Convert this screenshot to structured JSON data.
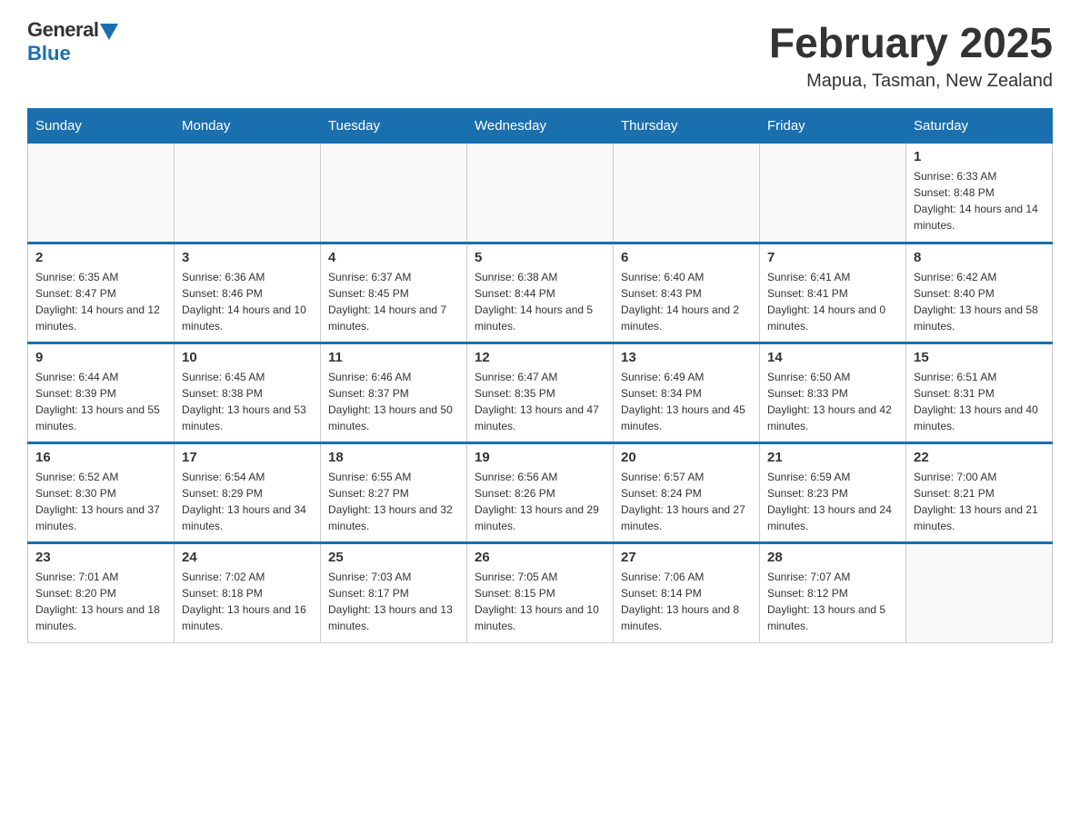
{
  "logo": {
    "general_text": "General",
    "blue_text": "Blue"
  },
  "header": {
    "title": "February 2025",
    "location": "Mapua, Tasman, New Zealand"
  },
  "weekdays": [
    "Sunday",
    "Monday",
    "Tuesday",
    "Wednesday",
    "Thursday",
    "Friday",
    "Saturday"
  ],
  "weeks": [
    [
      {
        "day": "",
        "info": ""
      },
      {
        "day": "",
        "info": ""
      },
      {
        "day": "",
        "info": ""
      },
      {
        "day": "",
        "info": ""
      },
      {
        "day": "",
        "info": ""
      },
      {
        "day": "",
        "info": ""
      },
      {
        "day": "1",
        "info": "Sunrise: 6:33 AM\nSunset: 8:48 PM\nDaylight: 14 hours and 14 minutes."
      }
    ],
    [
      {
        "day": "2",
        "info": "Sunrise: 6:35 AM\nSunset: 8:47 PM\nDaylight: 14 hours and 12 minutes."
      },
      {
        "day": "3",
        "info": "Sunrise: 6:36 AM\nSunset: 8:46 PM\nDaylight: 14 hours and 10 minutes."
      },
      {
        "day": "4",
        "info": "Sunrise: 6:37 AM\nSunset: 8:45 PM\nDaylight: 14 hours and 7 minutes."
      },
      {
        "day": "5",
        "info": "Sunrise: 6:38 AM\nSunset: 8:44 PM\nDaylight: 14 hours and 5 minutes."
      },
      {
        "day": "6",
        "info": "Sunrise: 6:40 AM\nSunset: 8:43 PM\nDaylight: 14 hours and 2 minutes."
      },
      {
        "day": "7",
        "info": "Sunrise: 6:41 AM\nSunset: 8:41 PM\nDaylight: 14 hours and 0 minutes."
      },
      {
        "day": "8",
        "info": "Sunrise: 6:42 AM\nSunset: 8:40 PM\nDaylight: 13 hours and 58 minutes."
      }
    ],
    [
      {
        "day": "9",
        "info": "Sunrise: 6:44 AM\nSunset: 8:39 PM\nDaylight: 13 hours and 55 minutes."
      },
      {
        "day": "10",
        "info": "Sunrise: 6:45 AM\nSunset: 8:38 PM\nDaylight: 13 hours and 53 minutes."
      },
      {
        "day": "11",
        "info": "Sunrise: 6:46 AM\nSunset: 8:37 PM\nDaylight: 13 hours and 50 minutes."
      },
      {
        "day": "12",
        "info": "Sunrise: 6:47 AM\nSunset: 8:35 PM\nDaylight: 13 hours and 47 minutes."
      },
      {
        "day": "13",
        "info": "Sunrise: 6:49 AM\nSunset: 8:34 PM\nDaylight: 13 hours and 45 minutes."
      },
      {
        "day": "14",
        "info": "Sunrise: 6:50 AM\nSunset: 8:33 PM\nDaylight: 13 hours and 42 minutes."
      },
      {
        "day": "15",
        "info": "Sunrise: 6:51 AM\nSunset: 8:31 PM\nDaylight: 13 hours and 40 minutes."
      }
    ],
    [
      {
        "day": "16",
        "info": "Sunrise: 6:52 AM\nSunset: 8:30 PM\nDaylight: 13 hours and 37 minutes."
      },
      {
        "day": "17",
        "info": "Sunrise: 6:54 AM\nSunset: 8:29 PM\nDaylight: 13 hours and 34 minutes."
      },
      {
        "day": "18",
        "info": "Sunrise: 6:55 AM\nSunset: 8:27 PM\nDaylight: 13 hours and 32 minutes."
      },
      {
        "day": "19",
        "info": "Sunrise: 6:56 AM\nSunset: 8:26 PM\nDaylight: 13 hours and 29 minutes."
      },
      {
        "day": "20",
        "info": "Sunrise: 6:57 AM\nSunset: 8:24 PM\nDaylight: 13 hours and 27 minutes."
      },
      {
        "day": "21",
        "info": "Sunrise: 6:59 AM\nSunset: 8:23 PM\nDaylight: 13 hours and 24 minutes."
      },
      {
        "day": "22",
        "info": "Sunrise: 7:00 AM\nSunset: 8:21 PM\nDaylight: 13 hours and 21 minutes."
      }
    ],
    [
      {
        "day": "23",
        "info": "Sunrise: 7:01 AM\nSunset: 8:20 PM\nDaylight: 13 hours and 18 minutes."
      },
      {
        "day": "24",
        "info": "Sunrise: 7:02 AM\nSunset: 8:18 PM\nDaylight: 13 hours and 16 minutes."
      },
      {
        "day": "25",
        "info": "Sunrise: 7:03 AM\nSunset: 8:17 PM\nDaylight: 13 hours and 13 minutes."
      },
      {
        "day": "26",
        "info": "Sunrise: 7:05 AM\nSunset: 8:15 PM\nDaylight: 13 hours and 10 minutes."
      },
      {
        "day": "27",
        "info": "Sunrise: 7:06 AM\nSunset: 8:14 PM\nDaylight: 13 hours and 8 minutes."
      },
      {
        "day": "28",
        "info": "Sunrise: 7:07 AM\nSunset: 8:12 PM\nDaylight: 13 hours and 5 minutes."
      },
      {
        "day": "",
        "info": ""
      }
    ]
  ]
}
